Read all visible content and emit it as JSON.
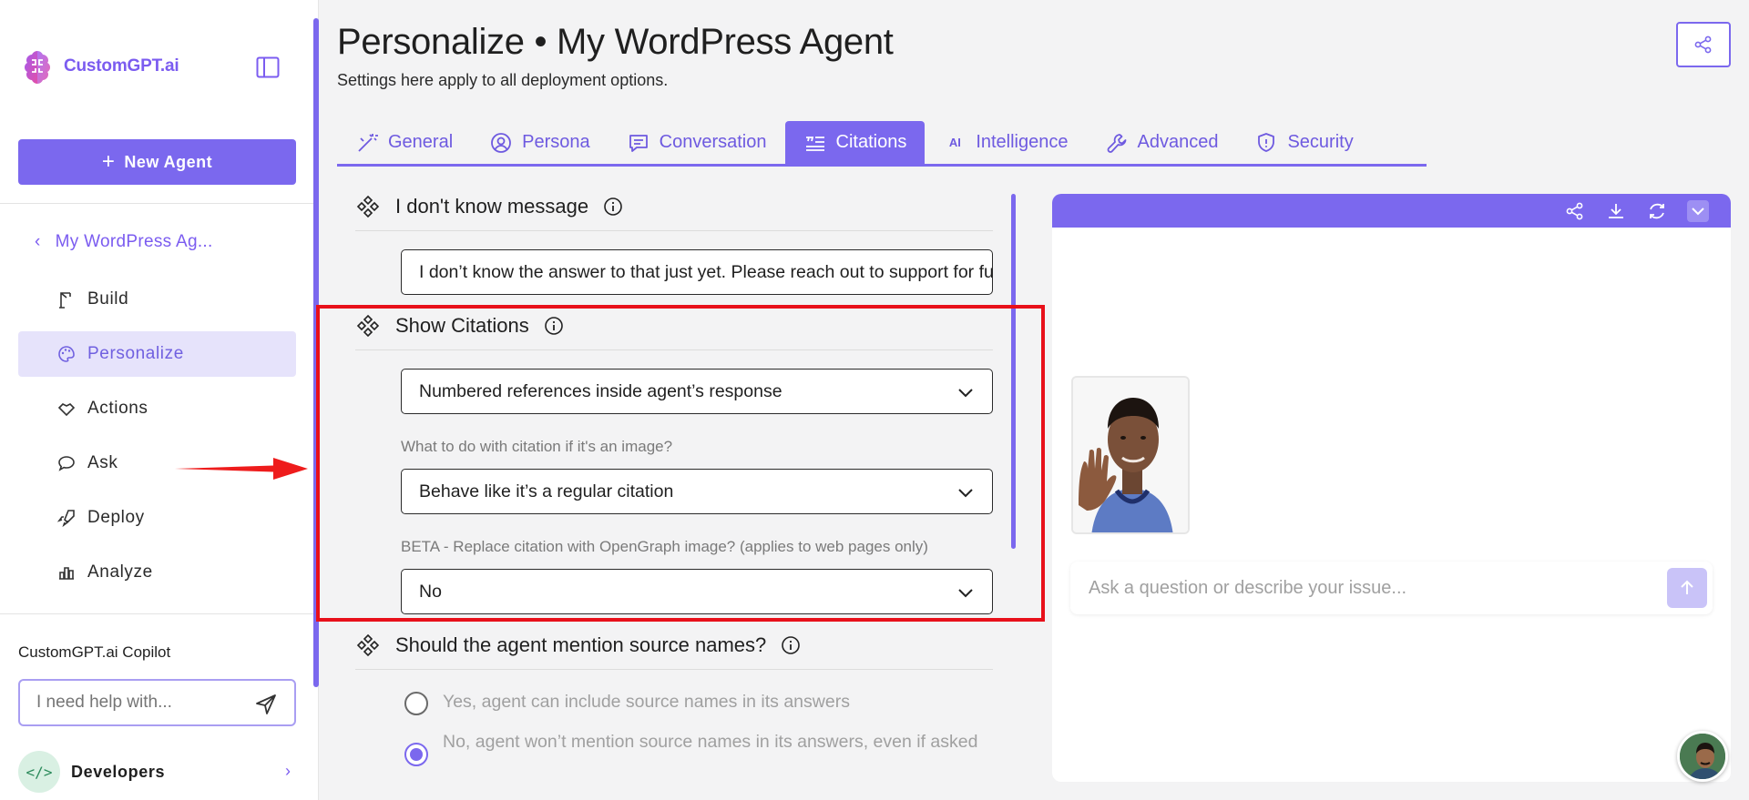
{
  "brand": {
    "name": "CustomGPT.ai"
  },
  "sidebar": {
    "new_agent_label": "New Agent",
    "back_agent_label": "My WordPress Ag...",
    "items": [
      {
        "label": "Build",
        "icon": "crane-icon"
      },
      {
        "label": "Personalize",
        "icon": "palette-icon"
      },
      {
        "label": "Actions",
        "icon": "handshake-icon"
      },
      {
        "label": "Ask",
        "icon": "chat-bubble-icon"
      },
      {
        "label": "Deploy",
        "icon": "rocket-icon"
      },
      {
        "label": "Analyze",
        "icon": "bar-chart-icon"
      }
    ],
    "active_item": "Personalize",
    "copilot_title": "CustomGPT.ai Copilot",
    "copilot_placeholder": "I need help with...",
    "developers_label": "Developers"
  },
  "header": {
    "title": "Personalize • My WordPress Agent",
    "subtitle": "Settings here apply to all deployment options."
  },
  "tabs": [
    {
      "label": "General",
      "icon": "wand-icon"
    },
    {
      "label": "Persona",
      "icon": "user-circle-icon"
    },
    {
      "label": "Conversation",
      "icon": "message-icon"
    },
    {
      "label": "Citations",
      "icon": "quote-list-icon"
    },
    {
      "label": "Intelligence",
      "icon": "ai-icon"
    },
    {
      "label": "Advanced",
      "icon": "wrench-icon"
    },
    {
      "label": "Security",
      "icon": "shield-icon"
    }
  ],
  "active_tab": "Citations",
  "settings": {
    "idk": {
      "title": "I don't know message",
      "value": "I don’t know the answer to that just yet. Please reach out to support for further help."
    },
    "citations": {
      "title": "Show Citations",
      "select_value": "Numbered references inside agent’s response",
      "image_label": "What to do with citation if it's an image?",
      "image_value": "Behave like it’s a regular citation",
      "og_label": "BETA - Replace citation with OpenGraph image? (applies to web pages only)",
      "og_value": "No"
    },
    "source_names": {
      "title": "Should the agent mention source names?",
      "options": [
        "Yes, agent can include source names in its answers",
        "No, agent won’t mention source names in its answers, even if asked"
      ],
      "selected_index": 1
    }
  },
  "preview": {
    "ask_placeholder": "Ask a question or describe your issue..."
  },
  "colors": {
    "accent": "#7b68ee",
    "highlight": "#e8101a",
    "active_bg": "#e6e3fb"
  }
}
